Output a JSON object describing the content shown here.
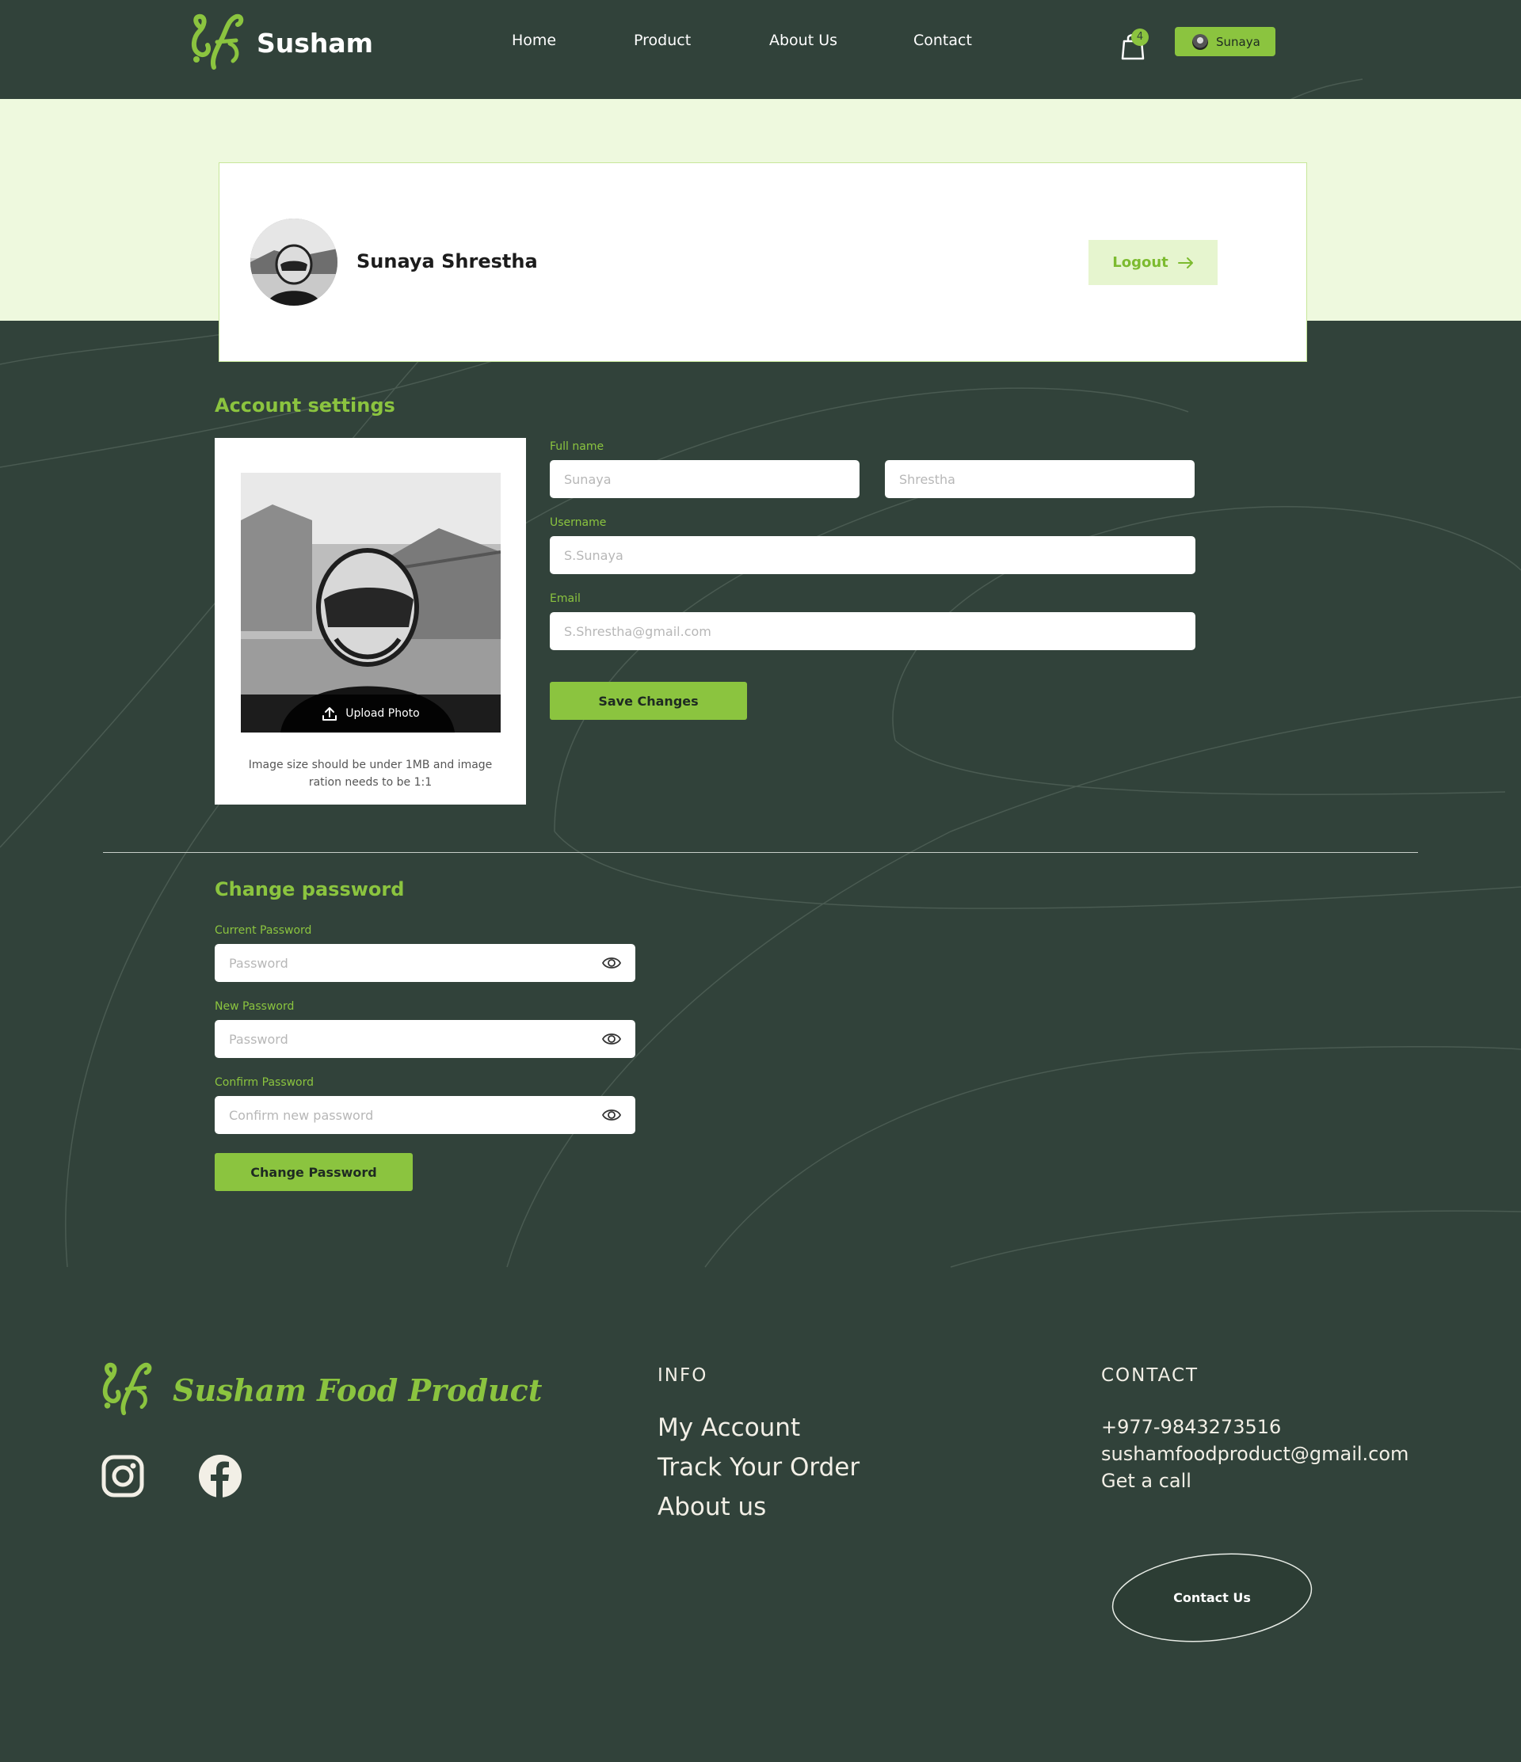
{
  "colors": {
    "background": "#31423a",
    "accent": "#8bc43f",
    "hero": "#eef9de",
    "cream": "#f2efe6"
  },
  "header": {
    "brand": "Susham",
    "nav": [
      {
        "label": "Home"
      },
      {
        "label": "Product"
      },
      {
        "label": "About Us"
      },
      {
        "label": "Contact"
      }
    ],
    "cart_count": "4",
    "user_chip": "Sunaya"
  },
  "profile": {
    "name": "Sunaya Shrestha",
    "logout_label": "Logout"
  },
  "account_settings": {
    "title": "Account settings",
    "upload_label": "Upload Photo",
    "photo_hint": "Image size should be under 1MB and image ration needs to be 1:1",
    "full_name_label": "Full name",
    "first_name_placeholder": "Sunaya",
    "last_name_placeholder": "Shrestha",
    "username_label": "Username",
    "username_placeholder": "S.Sunaya",
    "email_label": "Email",
    "email_placeholder": "S.Shrestha@gmail.com",
    "save_label": "Save Changes"
  },
  "change_password": {
    "title": "Change password",
    "current_label": "Current Password",
    "current_placeholder": "Password",
    "new_label": "New Password",
    "new_placeholder": "Password",
    "confirm_label": "Confirm Password",
    "confirm_placeholder": "Confirm new password",
    "submit_label": "Change Password"
  },
  "footer": {
    "brand": "Susham Food Product",
    "social": [
      "instagram-icon",
      "facebook-icon"
    ],
    "info_heading": "INFO",
    "info_links": [
      "My Account",
      "Track Your Order",
      "About us"
    ],
    "contact_heading": "CONTACT",
    "phone": "+977-9843273516",
    "email": "sushamfoodproduct@gmail.com",
    "call": "Get a call",
    "contact_button": "Contact Us"
  }
}
